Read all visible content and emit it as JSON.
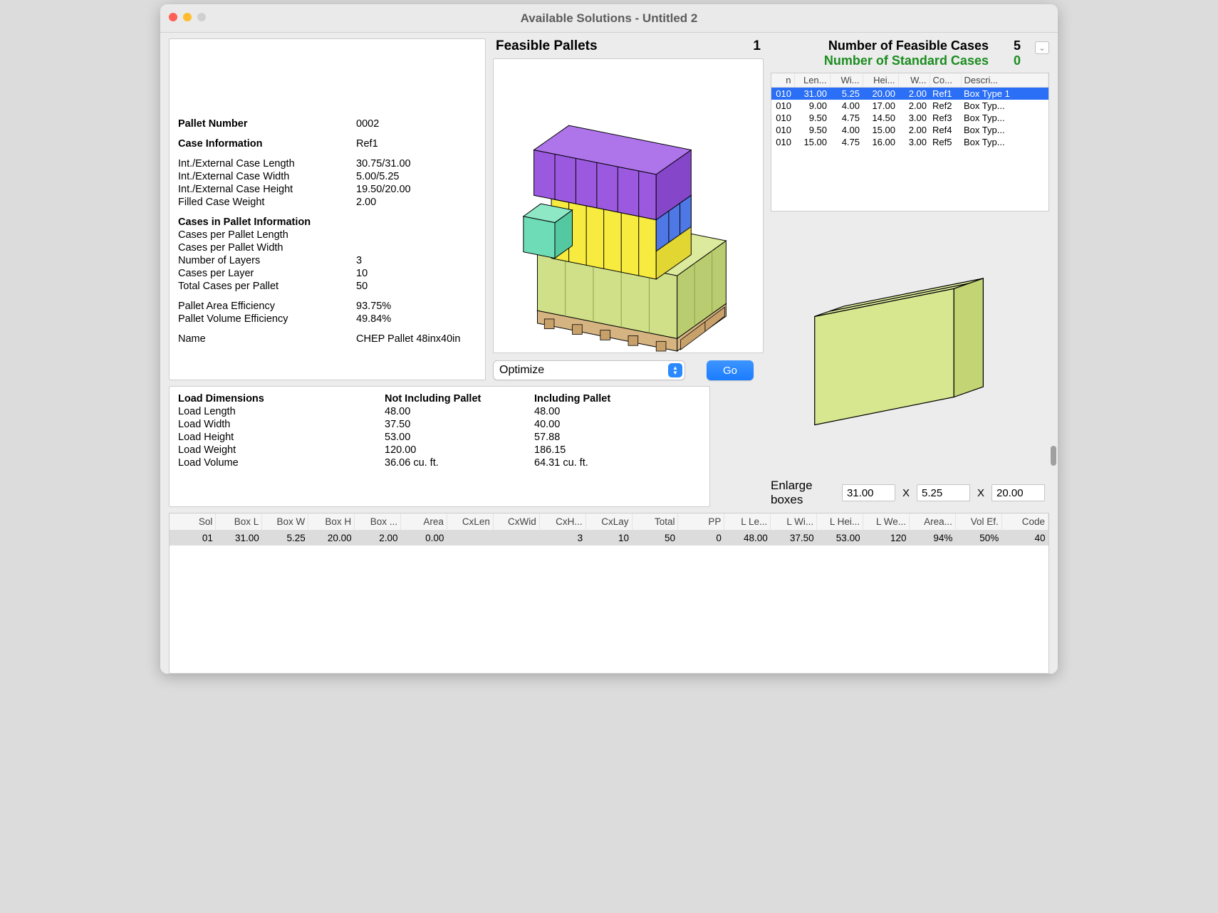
{
  "window": {
    "title": "Available Solutions - Untitled 2"
  },
  "info": {
    "palletNumber_label": "Pallet Number",
    "palletNumber": "0002",
    "caseInfo_label": "Case Information",
    "caseInfo": "Ref1",
    "caseLen_label": "Int./External Case Length",
    "caseLen": "30.75/31.00",
    "caseWid_label": "Int./External Case Width",
    "caseWid": "5.00/5.25",
    "caseHei_label": "Int./External Case Height",
    "caseHei": "19.50/20.00",
    "caseWei_label": "Filled Case Weight",
    "caseWei": "2.00",
    "cpi_label": "Cases in Pallet Information",
    "cpl_label": "Cases per Pallet Length",
    "cpl": "",
    "cpw_label": "Cases per Pallet Width",
    "cpw": "",
    "layers_label": "Number of Layers",
    "layers": "3",
    "cplayer_label": "Cases per Layer",
    "cplayer": "10",
    "total_label": "Total Cases per Pallet",
    "total": "50",
    "areaEff_label": "Pallet Area Efficiency",
    "areaEff": "93.75%",
    "volEff_label": "Pallet Volume Efficiency",
    "volEff": "49.84%",
    "name_label": "Name",
    "name": "CHEP Pallet 48inx40in"
  },
  "center": {
    "heading": "Feasible Pallets",
    "count": "1",
    "optimize_label": "Optimize",
    "go_label": "Go"
  },
  "load": {
    "hdr1": "Load Dimensions",
    "hdr2": "Not Including Pallet",
    "hdr3": "Including Pallet",
    "len_label": "Load Length",
    "len_a": "48.00",
    "len_b": "48.00",
    "wid_label": "Load Width",
    "wid_a": "37.50",
    "wid_b": "40.00",
    "hei_label": "Load Height",
    "hei_a": "53.00",
    "hei_b": "57.88",
    "wei_label": "Load Weight",
    "wei_a": "120.00",
    "wei_b": "186.15",
    "vol_label": "Load Volume",
    "vol_a": "36.06 cu. ft.",
    "vol_b": "64.31 cu. ft."
  },
  "right": {
    "feasible_label": "Number of Feasible Cases",
    "feasible_count": "5",
    "standard_label": "Number of Standard Cases",
    "standard_count": "0",
    "columns": [
      "n",
      "Len...",
      "Wi...",
      "Hei...",
      "W...",
      "Co...",
      "Descri..."
    ],
    "rows": [
      {
        "n": "010",
        "len": "31.00",
        "wid": "5.25",
        "hei": "20.00",
        "w": "2.00",
        "code": "Ref1",
        "desc": "Box Type 1"
      },
      {
        "n": "010",
        "len": "9.00",
        "wid": "4.00",
        "hei": "17.00",
        "w": "2.00",
        "code": "Ref2",
        "desc": "Box Typ..."
      },
      {
        "n": "010",
        "len": "9.50",
        "wid": "4.75",
        "hei": "14.50",
        "w": "3.00",
        "code": "Ref3",
        "desc": "Box Typ..."
      },
      {
        "n": "010",
        "len": "9.50",
        "wid": "4.00",
        "hei": "15.00",
        "w": "2.00",
        "code": "Ref4",
        "desc": "Box Typ..."
      },
      {
        "n": "010",
        "len": "15.00",
        "wid": "4.75",
        "hei": "16.00",
        "w": "3.00",
        "code": "Ref5",
        "desc": "Box Typ..."
      }
    ],
    "enlarge_label": "Enlarge boxes",
    "dimL": "31.00",
    "dimW": "5.25",
    "dimH": "20.00",
    "x": "X"
  },
  "solutions": {
    "columns": [
      "Sol",
      "Box L",
      "Box W",
      "Box H",
      "Box ...",
      "Area",
      "CxLen",
      "CxWid",
      "CxH...",
      "CxLay",
      "Total",
      "PP",
      "L Le...",
      "L Wi...",
      "L Hei...",
      "L We...",
      "Area...",
      "Vol Ef.",
      "Code"
    ],
    "row": {
      "sol": "01",
      "boxL": "31.00",
      "boxW": "5.25",
      "boxH": "20.00",
      "boxx": "2.00",
      "area": "0.00",
      "cxlen": "",
      "cxwid": "",
      "cxh": "3",
      "cxlay": "10",
      "total": "50",
      "pp": "0",
      "lle": "48.00",
      "lwi": "37.50",
      "lhei": "53.00",
      "lwe": "120",
      "areap": "94%",
      "volef": "50%",
      "code": "40"
    }
  }
}
